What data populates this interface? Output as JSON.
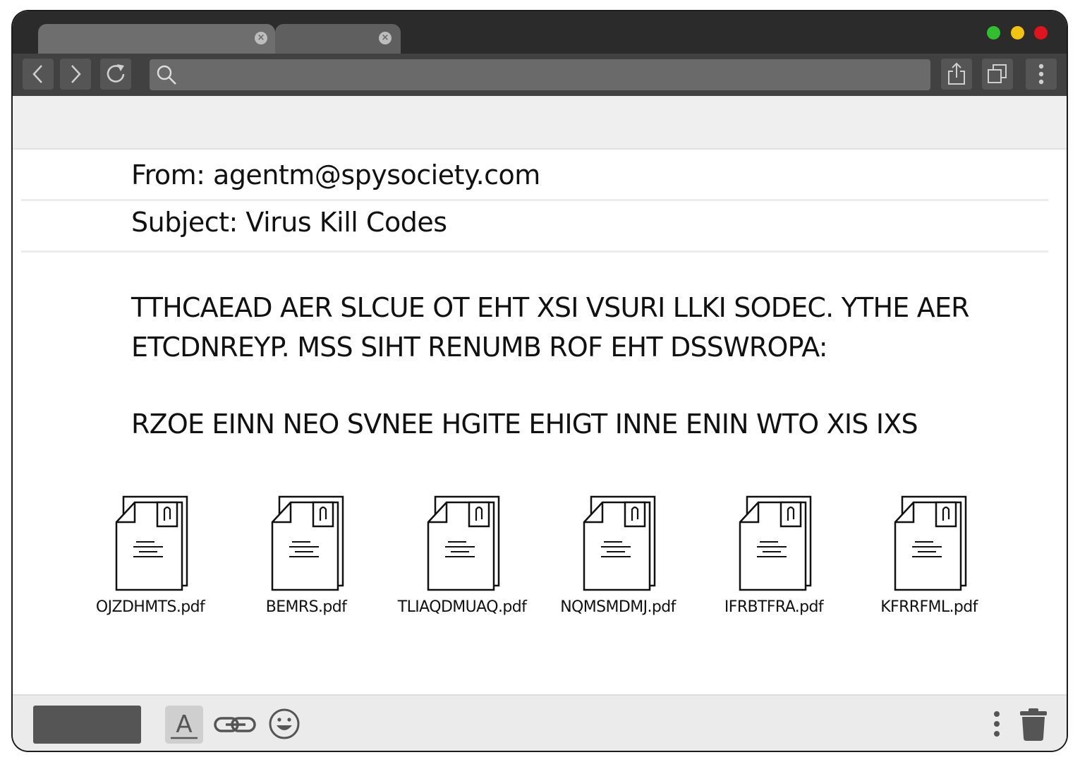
{
  "browser": {
    "tabs": [
      {
        "label": "",
        "close_glyph": "×"
      },
      {
        "label": "",
        "close_glyph": "×"
      }
    ],
    "window_controls": [
      "green",
      "yellow",
      "red"
    ],
    "address_bar": {
      "value": "",
      "placeholder": ""
    },
    "toolbar_icons": [
      "back-arrow-icon",
      "forward-arrow-icon",
      "reload-icon",
      "search-icon",
      "share-icon",
      "tabs-icon",
      "kebab-menu-icon"
    ]
  },
  "email": {
    "from": "From: agentm@spysociety.com",
    "subject": "Subject: Virus Kill Codes",
    "body": [
      "TTHCAEAD AER SLCUE OT EHT XSI VSURI LLKI SODEC. YTHE AER ETCDNREYP. MSS SIHT RENUMB ROF EHT DSSWROPA:",
      "RZOE EINN NEO SVNEE HGITE EHIGT INNE ENIN WTO XIS IXS"
    ],
    "attachments": [
      {
        "name": "OJZDHMTS.pdf"
      },
      {
        "name": "BEMRS.pdf"
      },
      {
        "name": "TLIAQDMUAQ.pdf"
      },
      {
        "name": "NQMSMDMJ.pdf"
      },
      {
        "name": "IFRBTFRA.pdf"
      },
      {
        "name": "KFRRFML.pdf"
      }
    ]
  },
  "compose_bar": {
    "send_label": "",
    "format_glyph": "A",
    "icons": [
      "text-format-icon",
      "link-icon",
      "emoji-icon",
      "more-options-icon",
      "trash-icon"
    ]
  },
  "colors": {
    "chrome_dark": "#2b2b2b",
    "toolbar": "#414141",
    "address_bar": "#6a6a6a",
    "dot_green": "#2fbf2f",
    "dot_yellow": "#f2c40f",
    "dot_red": "#e0141c"
  }
}
